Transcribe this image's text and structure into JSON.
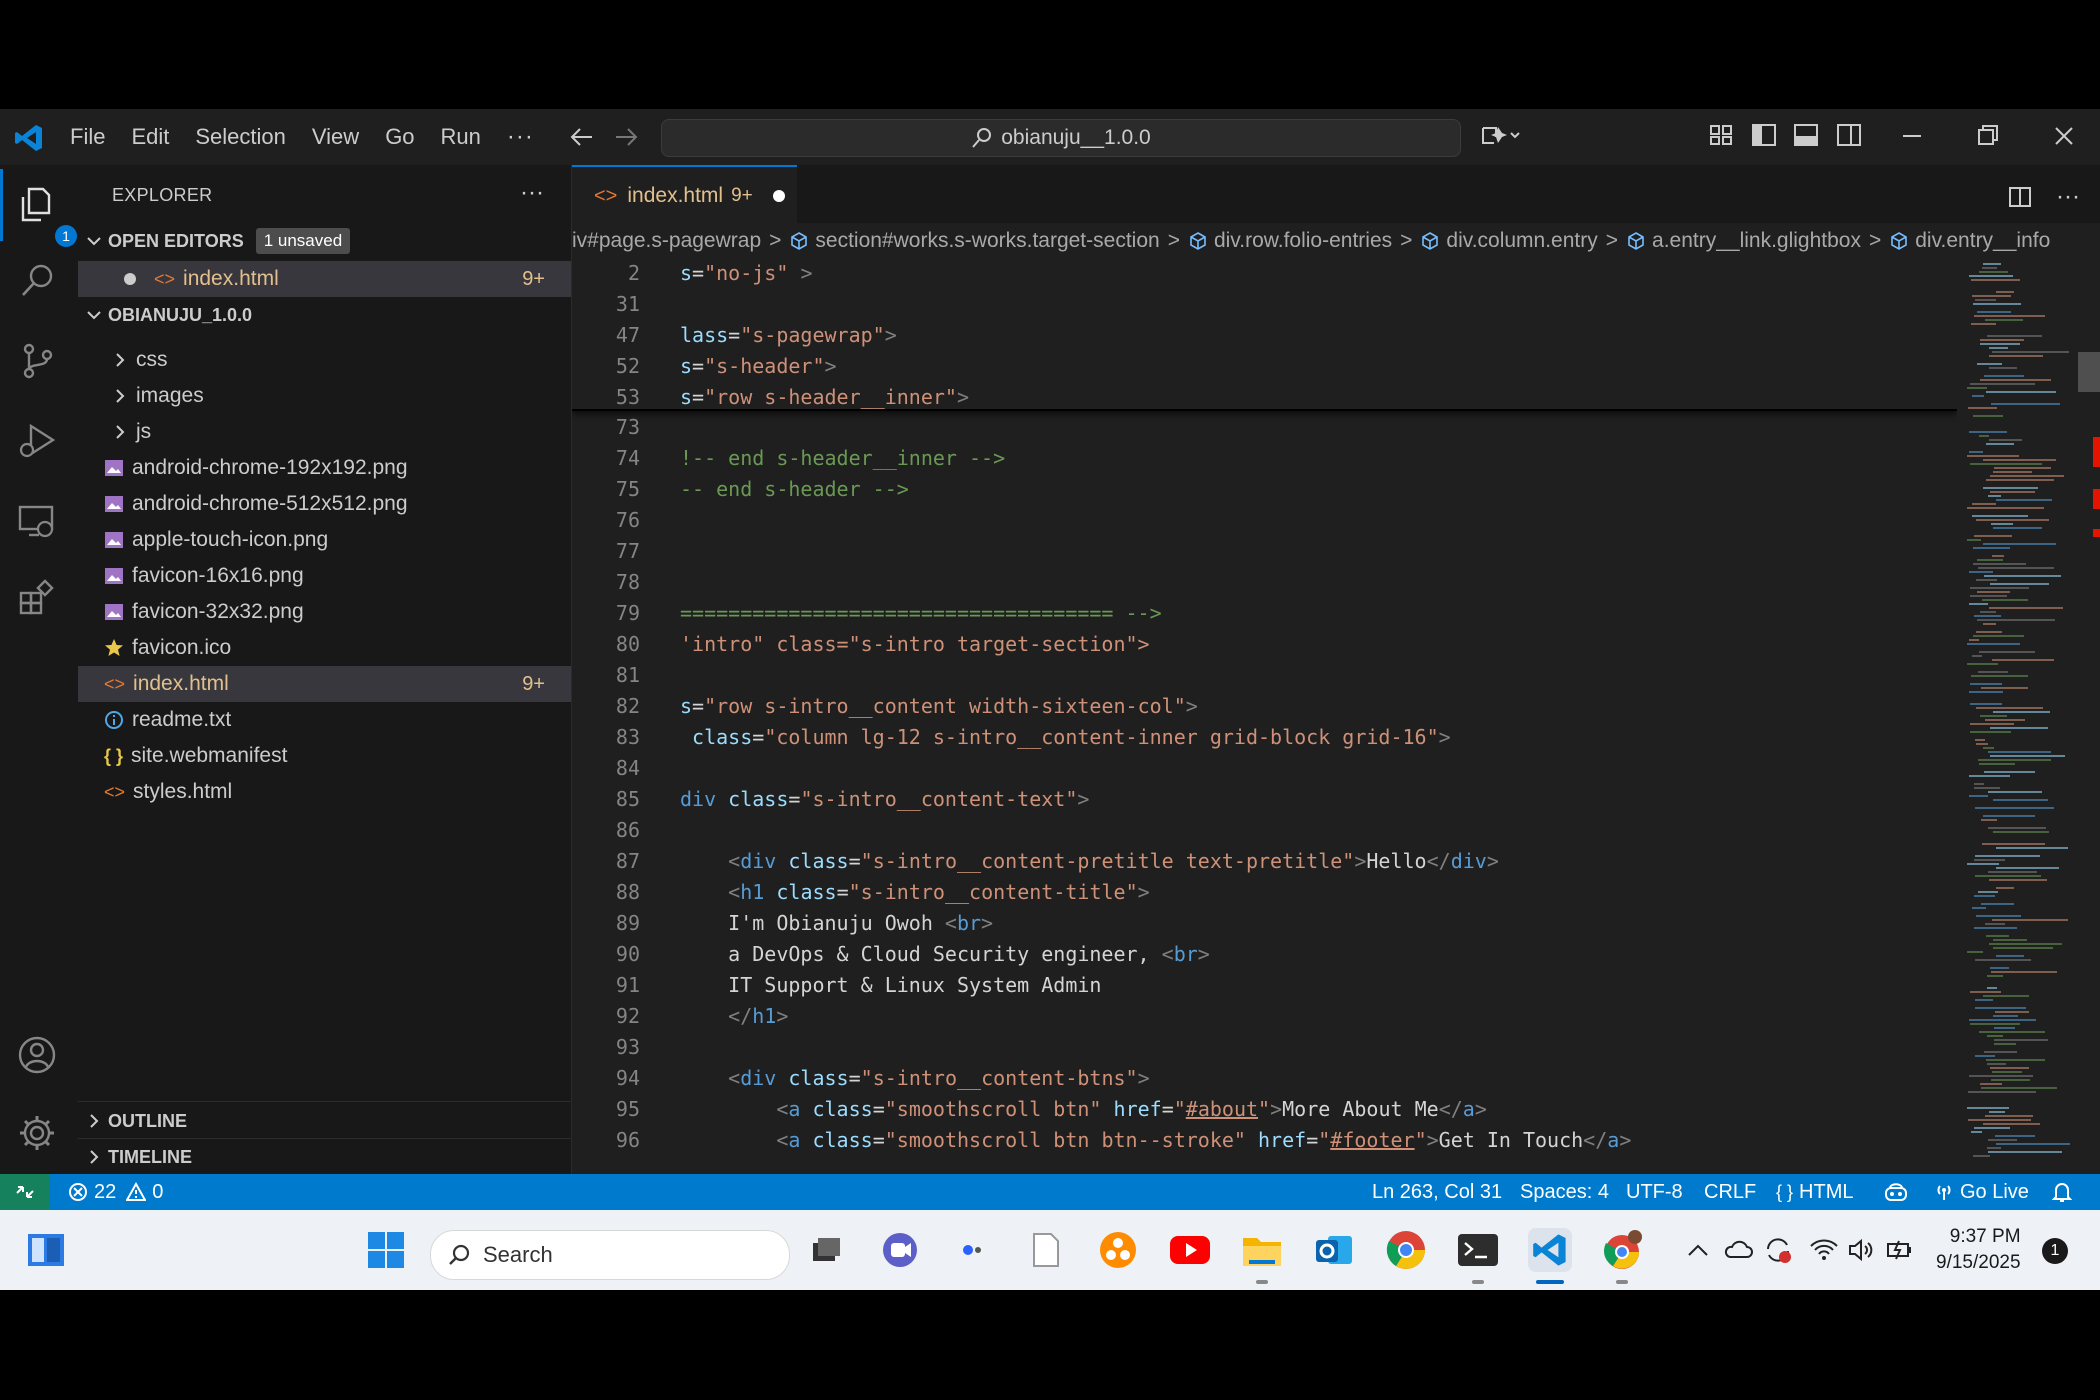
{
  "titlebar": {
    "menu": [
      "File",
      "Edit",
      "Selection",
      "View",
      "Go",
      "Run"
    ],
    "more": "···",
    "search_text": "obianuju__1.0.0"
  },
  "activity": {
    "explorer_badge": "1"
  },
  "sidebar": {
    "title": "EXPLORER",
    "more": "···",
    "open_editors": {
      "label": "OPEN EDITORS",
      "badge": "1 unsaved",
      "items": [
        {
          "name": "index.html",
          "count": "9+"
        }
      ]
    },
    "workspace": {
      "label": "OBIANUJU_1.0.0",
      "items": [
        {
          "name": "css",
          "type": "folder"
        },
        {
          "name": "images",
          "type": "folder"
        },
        {
          "name": "js",
          "type": "folder"
        },
        {
          "name": "android-chrome-192x192.png",
          "type": "image"
        },
        {
          "name": "android-chrome-512x512.png",
          "type": "image"
        },
        {
          "name": "apple-touch-icon.png",
          "type": "image"
        },
        {
          "name": "favicon-16x16.png",
          "type": "image"
        },
        {
          "name": "favicon-32x32.png",
          "type": "image"
        },
        {
          "name": "favicon.ico",
          "type": "star"
        },
        {
          "name": "index.html",
          "type": "html",
          "count": "9+"
        },
        {
          "name": "readme.txt",
          "type": "info"
        },
        {
          "name": "site.webmanifest",
          "type": "json"
        },
        {
          "name": "styles.html",
          "type": "html"
        }
      ]
    },
    "outline": "OUTLINE",
    "timeline": "TIMELINE"
  },
  "editor": {
    "tab": {
      "name": "index.html",
      "count": "9+"
    },
    "breadcrumb": [
      "iv#page.s-pagewrap",
      "section#works.s-works.target-section",
      "div.row.folio-entries",
      "div.column.entry",
      "a.entry__link.glightbox",
      "div.entry__info"
    ],
    "sticky_lines": [
      {
        "n": "2",
        "text": "s=\"no-js\" >"
      },
      {
        "n": "31",
        "text": ""
      },
      {
        "n": "47",
        "text": "lass=\"s-pagewrap\">"
      },
      {
        "n": "52",
        "text": "s=\"s-header\">"
      },
      {
        "n": "53",
        "text": "s=\"row s-header__inner\">"
      }
    ],
    "lines": [
      {
        "n": "73",
        "text": ""
      },
      {
        "n": "74",
        "text": "!-- end s-header__inner -->"
      },
      {
        "n": "75",
        "text": "-- end s-header -->"
      },
      {
        "n": "76",
        "text": ""
      },
      {
        "n": "77",
        "text": ""
      },
      {
        "n": "78",
        "text": ""
      },
      {
        "n": "79",
        "text": "==================================== -->"
      },
      {
        "n": "80",
        "text": "'intro\" class=\"s-intro target-section\">"
      },
      {
        "n": "81",
        "text": ""
      },
      {
        "n": "82",
        "text": "s=\"row s-intro__content width-sixteen-col\">"
      },
      {
        "n": "83",
        "text": " class=\"column lg-12 s-intro__content-inner grid-block grid-16\">"
      },
      {
        "n": "84",
        "text": ""
      },
      {
        "n": "85",
        "text": "div class=\"s-intro__content-text\">"
      },
      {
        "n": "86",
        "text": ""
      },
      {
        "n": "87",
        "text": "    <div class=\"s-intro__content-pretitle text-pretitle\">Hello</div>"
      },
      {
        "n": "88",
        "text": "    <h1 class=\"s-intro__content-title\">"
      },
      {
        "n": "89",
        "text": "    I'm Obianuju Owoh <br>"
      },
      {
        "n": "90",
        "text": "    a DevOps & Cloud Security engineer, <br>"
      },
      {
        "n": "91",
        "text": "    IT Support & Linux System Admin"
      },
      {
        "n": "92",
        "text": "    </h1>"
      },
      {
        "n": "93",
        "text": ""
      },
      {
        "n": "94",
        "text": "    <div class=\"s-intro__content-btns\">"
      },
      {
        "n": "95",
        "text": "        <a class=\"smoothscroll btn\" href=\"#about\">More About Me</a>"
      },
      {
        "n": "96",
        "text": "        <a class=\"smoothscroll btn btn--stroke\" href=\"#footer\">Get In Touch</a>"
      }
    ]
  },
  "statusbar": {
    "errors": "22",
    "warnings": "0",
    "position": "Ln 263, Col 31",
    "spaces": "Spaces: 4",
    "encoding": "UTF-8",
    "eol": "CRLF",
    "language": "HTML",
    "golive": "Go Live"
  },
  "taskbar": {
    "search": "Search",
    "time": "9:37 PM",
    "date": "9/15/2025",
    "notifications": "1"
  }
}
